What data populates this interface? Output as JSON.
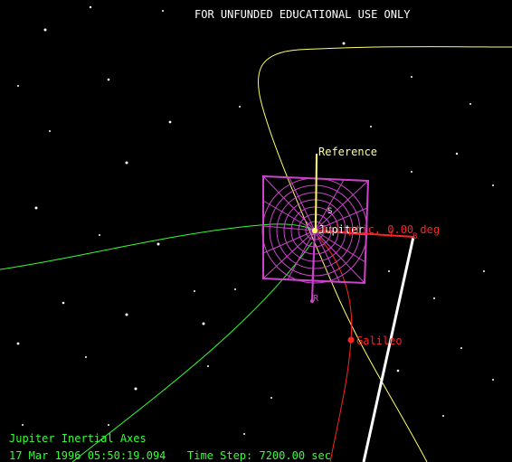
{
  "banner": "FOR UNFUNDED EDUCATIONAL USE ONLY",
  "status": {
    "frame": "Jupiter Inertial Axes",
    "epoch": "17 Mar 1996 05:50:19.094",
    "time_step": "Time Step: 7200.00 sec"
  },
  "scene": {
    "reference_label": "Reference",
    "angle_label": "Ecliptic, 0.00 deg",
    "angle_label_overprint": "Jupiter",
    "spacecraft_label": "Galileo",
    "axis_r_label": "R",
    "axis_s_label": "S",
    "axis_t_label": "T",
    "axis_b_label": "B"
  },
  "colors": {
    "background": "#000000",
    "banner_text": "#ffffff",
    "status_text": "#33ff33",
    "jupiter_orbit": "#ffff66",
    "green_orbit": "#33ff33",
    "galileo_trajectory": "#ff2222",
    "reference_plane": "#cc44cc",
    "sun_vector": "#ffffff",
    "stars": "#ffffff"
  },
  "icons": {
    "spacecraft": "galileo-dot-icon",
    "planet": "jupiter-icon"
  }
}
